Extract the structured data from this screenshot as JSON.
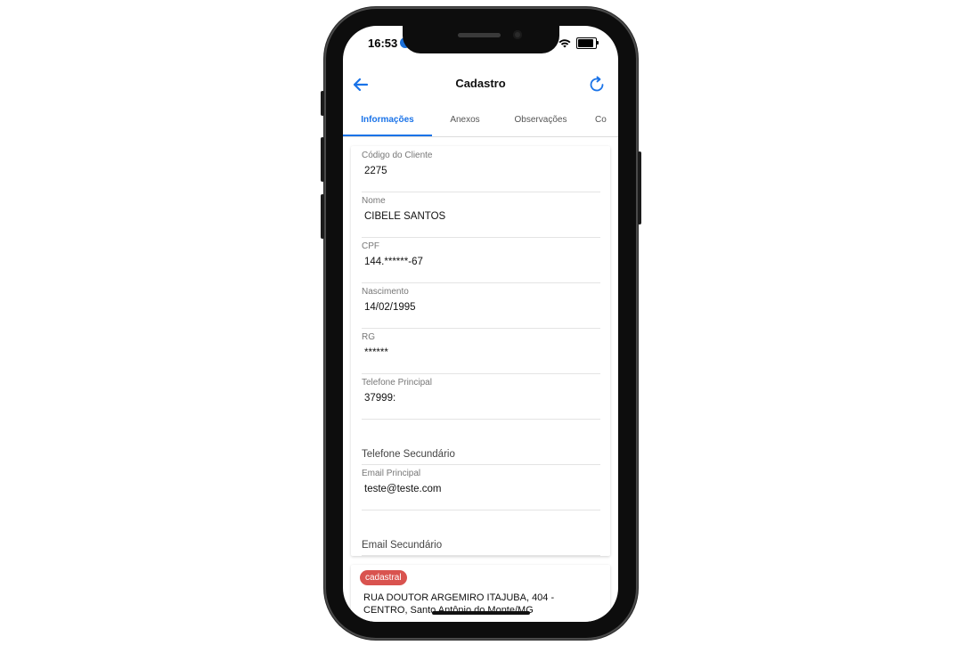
{
  "status_bar": {
    "time": "16:53",
    "icons": [
      "wifi-icon",
      "battery-icon"
    ]
  },
  "header": {
    "title": "Cadastro",
    "back_icon": "arrow-left-icon",
    "refresh_icon": "refresh-icon"
  },
  "tabs": [
    {
      "label": "Informações",
      "active": true
    },
    {
      "label": "Anexos",
      "active": false
    },
    {
      "label": "Observações",
      "active": false
    },
    {
      "label": "Co",
      "active": false
    }
  ],
  "fields": {
    "codigo": {
      "label": "Código do Cliente",
      "value": "2275"
    },
    "nome": {
      "label": "Nome",
      "value": "CIBELE SANTOS"
    },
    "cpf": {
      "label": "CPF",
      "value": "144.******-67"
    },
    "nascimento": {
      "label": "Nascimento",
      "value": "14/02/1995"
    },
    "rg": {
      "label": "RG",
      "value": "******"
    },
    "telefone_principal": {
      "label": "Telefone Principal",
      "value": "37999:"
    },
    "telefone_secundario": {
      "placeholder": "Telefone Secundário"
    },
    "email_principal": {
      "label": "Email Principal",
      "value": "teste@teste.com"
    },
    "email_secundario": {
      "placeholder": "Email Secundário"
    }
  },
  "address_card": {
    "badge": "cadastral",
    "line1": "RUA DOUTOR ARGEMIRO ITAJUBA, 404 -",
    "line2": "CENTRO, Santo Antônio do Monte/MG"
  },
  "colors": {
    "accent": "#1a73e8",
    "badge": "#d9534f"
  }
}
